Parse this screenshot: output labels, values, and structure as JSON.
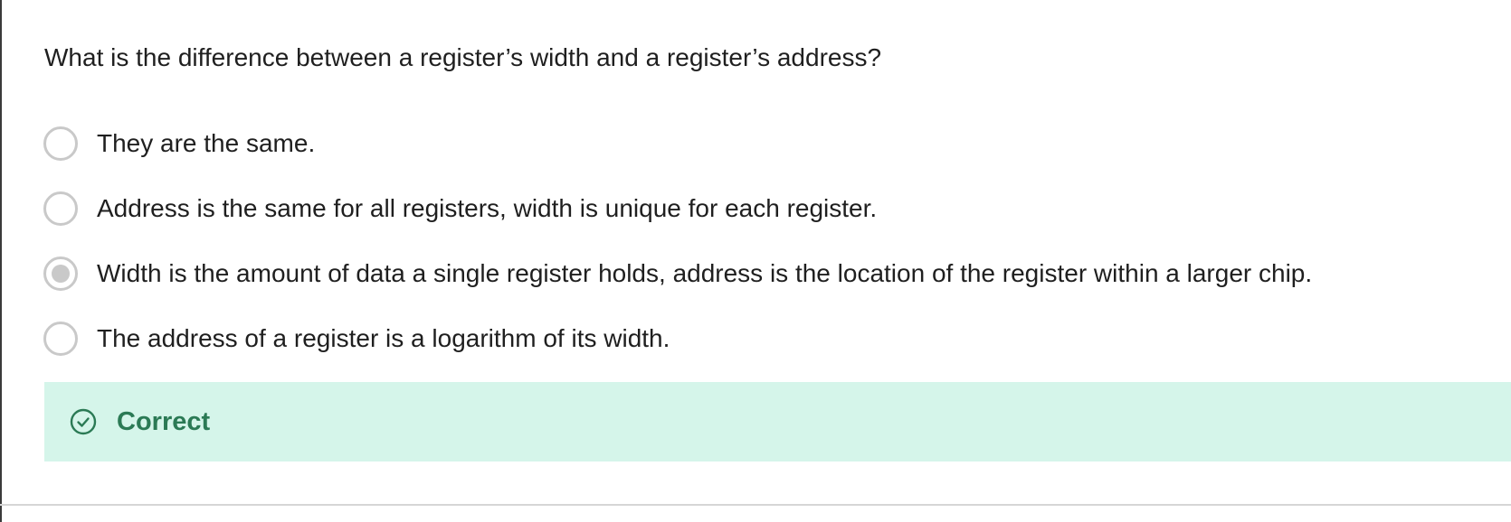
{
  "question": {
    "text": "What is the difference between a register’s width and a register’s address?"
  },
  "options": [
    {
      "label": "They are the same.",
      "selected": false
    },
    {
      "label": "Address is the same for all registers, width is unique for each register.",
      "selected": false
    },
    {
      "label": "Width is the amount of data a single register holds, address is the location of the register within a larger chip.",
      "selected": true
    },
    {
      "label": "The address of a register is a logarithm of its width.",
      "selected": false
    }
  ],
  "feedback": {
    "label": "Correct",
    "icon": "check-circle-icon",
    "color": "#2b7a55",
    "background": "#d5f5ea"
  }
}
